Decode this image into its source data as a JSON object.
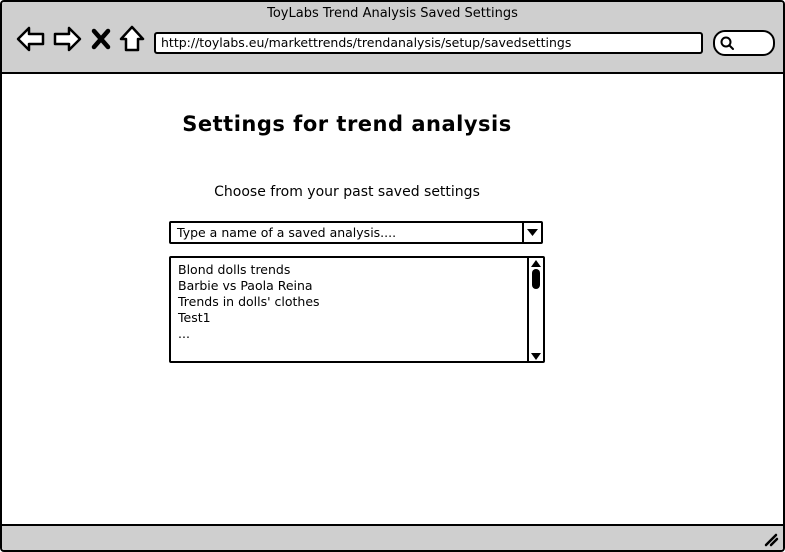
{
  "window": {
    "title": "ToyLabs Trend Analysis Saved Settings"
  },
  "toolbar": {
    "icons": [
      "back-arrow-icon",
      "forward-arrow-icon",
      "close-x-icon",
      "home-icon"
    ],
    "url": "http://toylabs.eu/markettrends/trendanalysis/setup/savedsettings",
    "search_icon": "search-icon"
  },
  "main": {
    "title": "Settings for trend analysis",
    "subtitle": "Choose from your past saved settings",
    "combo": {
      "placeholder": "Type a name of a saved analysis....",
      "arrow_icon": "chevron-down-icon"
    },
    "saved_list": {
      "items": [
        "Blond dolls trends",
        "Barbie vs Paola Reina",
        "Trends in dolls' clothes",
        "Test1",
        "..."
      ]
    }
  },
  "colors": {
    "chrome_bar": "#cfcfcf",
    "page_background": "#ffffff",
    "outline": "#000000"
  }
}
